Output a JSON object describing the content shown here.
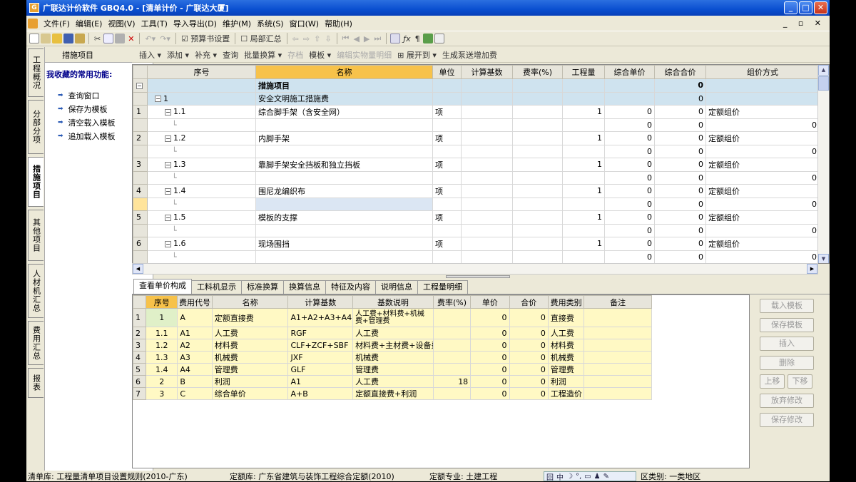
{
  "window": {
    "title": "广联达计价软件 GBQ4.0 - [清单计价 - 广联达大厦]"
  },
  "menu": [
    "文件(F)",
    "编辑(E)",
    "视图(V)",
    "工具(T)",
    "导入导出(D)",
    "维护(M)",
    "系统(S)",
    "窗口(W)",
    "帮助(H)"
  ],
  "toolbar": {
    "budget_settings": "预算书设置",
    "partial_summary": "局部汇总"
  },
  "left_tabs": [
    "工程概况",
    "分部分项",
    "措施项目",
    "其他项目",
    "人材机汇总",
    "费用汇总",
    "报表"
  ],
  "panel": {
    "title": "措施项目",
    "favorites_label": "我收藏的常用功能:",
    "items": [
      "查询窗口",
      "保存为模板",
      "清空载入模板",
      "追加载入模板"
    ]
  },
  "sub_toolbar": [
    "插入",
    "添加",
    "补充",
    "查询",
    "批量换算",
    "存档",
    "模板",
    "编辑实物量明细",
    "展开到",
    "生成泵送增加费"
  ],
  "grid": {
    "headers": [
      "序号",
      "名称",
      "单位",
      "计算基数",
      "费率(%)",
      "工程量",
      "综合单价",
      "综合合价",
      "组价方式"
    ],
    "title_row": {
      "name": "措施项目",
      "total": "0"
    },
    "group": {
      "seq": "1",
      "name": "安全文明施工措施费",
      "total": "0"
    },
    "items": [
      {
        "row": "1",
        "seq": "1.1",
        "name": "综合脚手架（含安全网）",
        "unit": "项",
        "qty": "1",
        "price": "0",
        "total": "0",
        "method": "定额组价"
      },
      {
        "row": "2",
        "seq": "1.2",
        "name": "内脚手架",
        "unit": "项",
        "qty": "1",
        "price": "0",
        "total": "0",
        "method": "定额组价"
      },
      {
        "row": "3",
        "seq": "1.3",
        "name": "靠脚手架安全挡板和独立挡板",
        "unit": "项",
        "qty": "1",
        "price": "0",
        "total": "0",
        "method": "定额组价"
      },
      {
        "row": "4",
        "seq": "1.4",
        "name": "围尼龙编织布",
        "unit": "项",
        "qty": "1",
        "price": "0",
        "total": "0",
        "method": "定额组价"
      },
      {
        "row": "5",
        "seq": "1.5",
        "name": "模板的支撑",
        "unit": "项",
        "qty": "1",
        "price": "0",
        "total": "0",
        "method": "定额组价"
      },
      {
        "row": "6",
        "seq": "1.6",
        "name": "现场围挡",
        "unit": "项",
        "qty": "1",
        "price": "0",
        "total": "0",
        "method": "定额组价"
      }
    ],
    "sub_qty": "0",
    "sub_price": "0",
    "sub_total": "0"
  },
  "tabs2": [
    "查看单价构成",
    "工料机显示",
    "标准换算",
    "换算信息",
    "特征及内容",
    "说明信息",
    "工程量明细"
  ],
  "grid2": {
    "headers": [
      "序号",
      "费用代号",
      "名称",
      "计算基数",
      "基数说明",
      "费率(%)",
      "单价",
      "合价",
      "费用类别",
      "备注"
    ],
    "rows": [
      {
        "row": "1",
        "seq": "1",
        "code": "A",
        "name": "定额直接费",
        "base": "A1+A2+A3+A4",
        "desc": "人工费+材料费+机械费+管理费",
        "rate": "",
        "price": "0",
        "total": "0",
        "cat": "直接费"
      },
      {
        "row": "2",
        "seq": "1.1",
        "code": "A1",
        "name": "人工费",
        "base": "RGF",
        "desc": "人工费",
        "rate": "",
        "price": "0",
        "total": "0",
        "cat": "人工费"
      },
      {
        "row": "3",
        "seq": "1.2",
        "code": "A2",
        "name": "材料费",
        "base": "CLF+ZCF+SBF",
        "desc": "材料费+主材费+设备费",
        "rate": "",
        "price": "0",
        "total": "0",
        "cat": "材料费"
      },
      {
        "row": "4",
        "seq": "1.3",
        "code": "A3",
        "name": "机械费",
        "base": "JXF",
        "desc": "机械费",
        "rate": "",
        "price": "0",
        "total": "0",
        "cat": "机械费"
      },
      {
        "row": "5",
        "seq": "1.4",
        "code": "A4",
        "name": "管理费",
        "base": "GLF",
        "desc": "管理费",
        "rate": "",
        "price": "0",
        "total": "0",
        "cat": "管理费"
      },
      {
        "row": "6",
        "seq": "2",
        "code": "B",
        "name": "利润",
        "base": "A1",
        "desc": "人工费",
        "rate": "18",
        "price": "0",
        "total": "0",
        "cat": "利润"
      },
      {
        "row": "7",
        "seq": "3",
        "code": "C",
        "name": "综合单价",
        "base": "A+B",
        "desc": "定额直接费+利润",
        "rate": "",
        "price": "0",
        "total": "0",
        "cat": "工程造价"
      }
    ]
  },
  "right_buttons": {
    "load": "载入模板",
    "save": "保存模板",
    "insert": "插入",
    "delete": "删除",
    "up": "上移",
    "down": "下移",
    "discard": "放弃修改",
    "save_changes": "保存修改"
  },
  "status": {
    "list_lib": "清单库: 工程量清单项目设置规则(2010-广东)",
    "quota_lib": "定额库: 广东省建筑与装饰工程综合定额(2010)",
    "major": "定额专业: 土建工程",
    "region": "区类别: 一类地区"
  }
}
